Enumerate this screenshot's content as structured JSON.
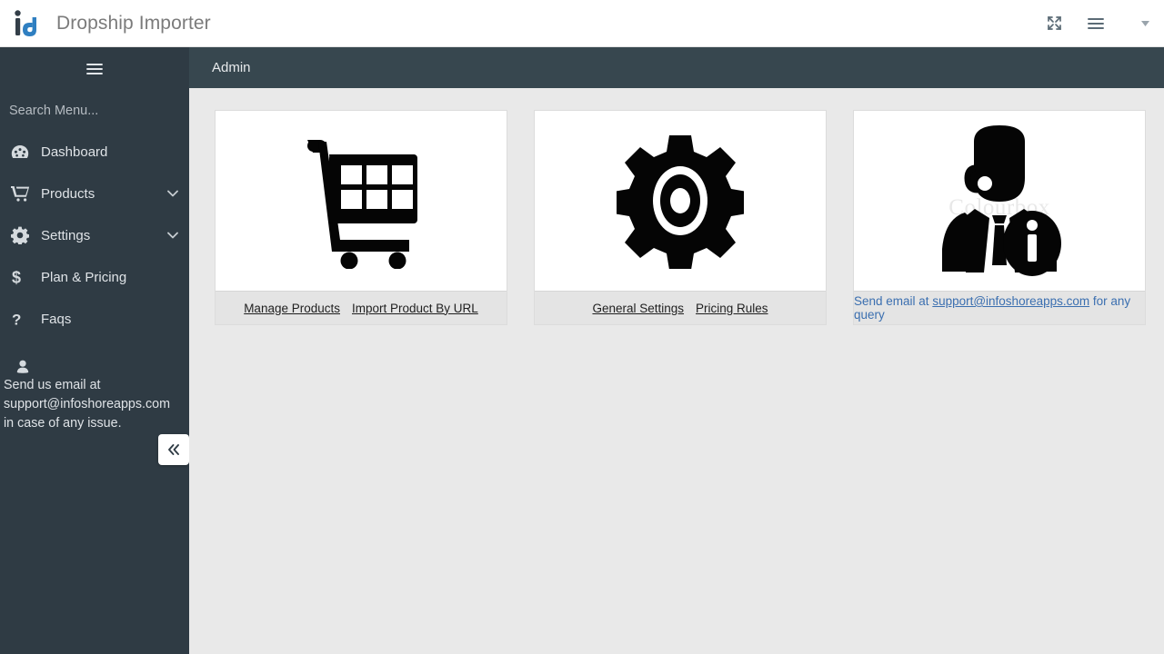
{
  "header": {
    "brand_title": "Dropship Importer",
    "logo_name": "infoshore-logo",
    "actions": [
      {
        "name": "fullscreen-icon",
        "label": "Fullscreen"
      },
      {
        "name": "menu-icon",
        "label": "Menu"
      }
    ],
    "caret_label": "▾"
  },
  "sidebar": {
    "toggle_label": "Toggle Menu",
    "search": {
      "placeholder": "Search Menu...",
      "value": ""
    },
    "items": [
      {
        "label": "Dashboard",
        "icon": "dashboard-icon",
        "caret": false
      },
      {
        "label": "Products",
        "icon": "cart-icon",
        "caret": true
      },
      {
        "label": "Settings",
        "icon": "gear-icon",
        "caret": true
      },
      {
        "label": "Plan & Pricing",
        "icon": "dollar-icon",
        "caret": false
      },
      {
        "label": "Faqs",
        "icon": "question-icon",
        "caret": false
      }
    ],
    "note": "Send us email at support@infoshoreapps.com in case of any issue.",
    "note_icon": "user-icon",
    "collapse_label": "«"
  },
  "page": {
    "title": "Admin"
  },
  "cards": [
    {
      "icon": "shopping-cart-image",
      "links": [
        {
          "label": "Manage Products"
        },
        {
          "label": "Import Product By URL"
        }
      ]
    },
    {
      "icon": "gear-image",
      "links": [
        {
          "label": "General Settings"
        },
        {
          "label": "Pricing Rules"
        }
      ]
    },
    {
      "icon": "support-agent-image",
      "watermark": "Colourbox",
      "support": {
        "prefix": "Send email at ",
        "email": "support@infoshoreapps.com",
        "suffix": " for any query"
      }
    }
  ],
  "colors": {
    "sidebar_bg": "#2f3b44",
    "pagebar_bg": "#37474f",
    "page_bg": "#e9e9e9",
    "link_blue": "#3b6fb0",
    "brand_blue": "#2f7fc1"
  }
}
